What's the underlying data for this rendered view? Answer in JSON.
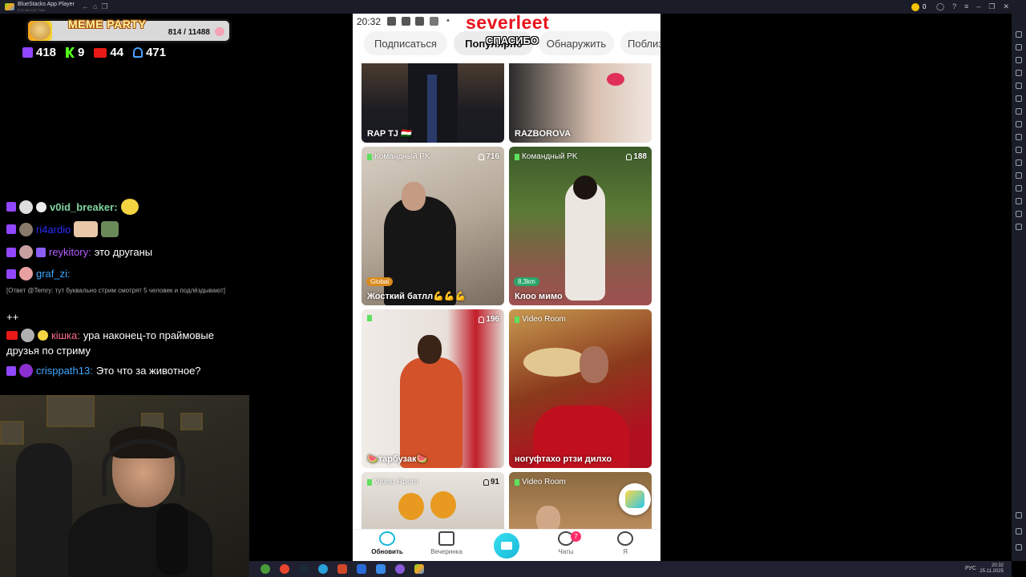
{
  "bluestacks": {
    "title": "BlueStacks App Player",
    "subtitle": "5.22.150.1027 N64",
    "coins": "0"
  },
  "overlay": {
    "meme_title": "MEME PARTY",
    "meme_count": "814 / 11488",
    "meme_progress": 0.071,
    "stats": {
      "twitch": "418",
      "kick": "9",
      "live": "44",
      "viewers": "471"
    }
  },
  "chat": [
    {
      "platform": "twitch",
      "user": "v0id_breaker:",
      "color": "#7fd4a0",
      "text": ""
    },
    {
      "platform": "twitch",
      "user": "ri4ardio",
      "color": "#2c2cff",
      "text": ""
    },
    {
      "platform": "twitch",
      "user": "reykitory:",
      "color": "#b35cff",
      "text": "это друганы"
    },
    {
      "platform": "twitch",
      "user": "graf_zi:",
      "color": "#3da8ff",
      "text": ""
    },
    {
      "reply": "[Ответ @Temry: тут буквально стрим смотрят 5 человек и подлёздывают]"
    },
    {
      "text": "++"
    },
    {
      "platform": "live",
      "user": "кішка:",
      "color": "#ff6f8a",
      "text": "ура наконец-то праймовые",
      "text2": "друзья по стриму"
    },
    {
      "platform": "twitch",
      "user": "crisppath13:",
      "color": "#3da8ff",
      "text": "Это что за животное?"
    }
  ],
  "phone": {
    "time": "20:32",
    "overlay_name": "severleet",
    "overlay_thanks": "СПАСИБО",
    "tabs": [
      "Подписаться",
      "Популярно",
      "Обнаружить",
      "Поблиз"
    ],
    "cards": [
      {
        "title": "RAP TJ 🇹🇯",
        "tag": "",
        "viewers": ""
      },
      {
        "title": "RAZBOROVA",
        "tag": "",
        "viewers": ""
      },
      {
        "title": "Жосткий батлл💪💪💪",
        "tag": "Командный PK",
        "viewers": "716",
        "chip": "Global"
      },
      {
        "title": "Клоо мимо",
        "tag": "Командный PK",
        "viewers": "188",
        "chip": "8,3km"
      },
      {
        "title": "🍉тарбузак🍉",
        "tag": "",
        "viewers": "196"
      },
      {
        "title": "ногуфтахо ртзи дилхо",
        "tag": "Video Room",
        "viewers": ""
      },
      {
        "title": "",
        "tag": "Video Room",
        "viewers": "91"
      },
      {
        "title": "",
        "tag": "Video Room",
        "viewers": ""
      }
    ],
    "nav": [
      "Обновить",
      "Вечеринка",
      "",
      "Чаты",
      "Я"
    ],
    "chat_badge": "7"
  },
  "taskbar": {
    "lang": "РУС",
    "time": "20:32",
    "date": "25.11.2025"
  }
}
